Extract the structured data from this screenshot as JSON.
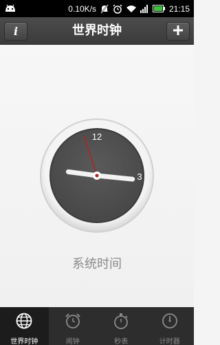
{
  "status_bar": {
    "network_speed": "0.10K/s",
    "time": "21:15",
    "icons": [
      "android-icon",
      "mute-icon",
      "alarm-icon",
      "wifi-icon",
      "signal-icon",
      "battery-icon"
    ]
  },
  "header": {
    "title": "世界时钟",
    "info_button_icon": "info-icon",
    "add_button_icon": "plus-icon"
  },
  "clock": {
    "label": "系统时间",
    "numerals": {
      "twelve": "12",
      "three": "3"
    },
    "time": {
      "hour": 9,
      "minute": 15,
      "second": 57
    }
  },
  "nav": {
    "items": [
      {
        "label": "世界时钟",
        "icon": "globe-icon",
        "active": true
      },
      {
        "label": "闹钟",
        "icon": "alarm-clock-icon",
        "active": false
      },
      {
        "label": "秒表",
        "icon": "stopwatch-icon",
        "active": false
      },
      {
        "label": "计时器",
        "icon": "timer-icon",
        "active": false
      }
    ]
  },
  "colors": {
    "accent_hand": "#b22222",
    "face": "#505050",
    "nav_bg": "#2d2d2d",
    "battery": "#3fbf3f"
  }
}
